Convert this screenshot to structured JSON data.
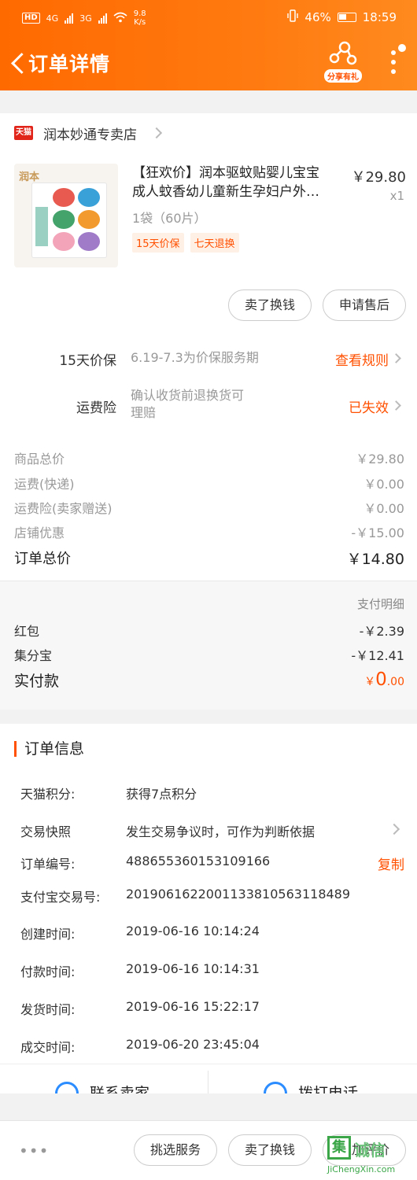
{
  "status_bar": {
    "hd": "HD",
    "net1": "4G",
    "net2": "3G",
    "speed_value": "9.8",
    "speed_unit": "K/s",
    "battery": "46%",
    "time": "18:59"
  },
  "header": {
    "title": "订单详情",
    "share_label": "分享有礼"
  },
  "store": {
    "badge": "天猫",
    "name": "润本妙通专卖店"
  },
  "product": {
    "brand_text": "润本",
    "title_line1": "【狂欢价】润本驱蚊贴婴儿宝宝",
    "title_line2": "成人蚊香幼儿童新生孕妇户外…",
    "price": "￥29.80",
    "qty": "x1",
    "spec": "1袋（60片）",
    "tags": [
      "15天价保",
      "七天退换"
    ]
  },
  "item_actions": {
    "sell_label": "卖了换钱",
    "aftersale_label": "申请售后"
  },
  "services": [
    {
      "label": "15天价保",
      "desc": "6.19-7.3为价保服务期",
      "action": "查看规则"
    },
    {
      "label": "运费险",
      "desc_line1": "确认收货前退换货可",
      "desc_line2": "理赔",
      "action": "已失效"
    }
  ],
  "price_rows": [
    {
      "label": "商品总价",
      "value": "￥29.80"
    },
    {
      "label": "运费(快递)",
      "value": "￥0.00"
    },
    {
      "label": "运费险(卖家赠送)",
      "value": "￥0.00"
    },
    {
      "label": "店铺优惠",
      "value": "-￥15.00"
    }
  ],
  "order_total": {
    "label": "订单总价",
    "value": "￥14.80"
  },
  "payment": {
    "header": "支付明细",
    "rows": [
      {
        "label": "红包",
        "value": "-￥2.39"
      },
      {
        "label": "集分宝",
        "value": "-￥12.41"
      }
    ],
    "real_label": "实付款",
    "real_currency": "￥",
    "real_int": "0",
    "real_dec": ".00"
  },
  "order_info": {
    "title": "订单信息",
    "rows": [
      {
        "key": "天猫积分:",
        "value": "获得7点积分"
      },
      {
        "key": "交易快照",
        "value": "发生交易争议时，可作为判断依据"
      },
      {
        "key": "订单编号:",
        "value": "488655360153109166",
        "action": "复制"
      },
      {
        "key": "支付宝交易号:",
        "value": "2019061622001133810563118489"
      },
      {
        "key": "创建时间:",
        "value": "2019-06-16 10:14:24"
      },
      {
        "key": "付款时间:",
        "value": "2019-06-16 10:14:31"
      },
      {
        "key": "发货时间:",
        "value": "2019-06-16 15:22:17"
      },
      {
        "key": "成交时间:",
        "value": "2019-06-20 23:45:04"
      }
    ]
  },
  "contact": {
    "seller_label": "联系卖家",
    "phone_label": "拨打电话"
  },
  "bottom_bar": {
    "more": "•••",
    "buttons": [
      "挑选服务",
      "卖了换钱",
      "追加评价"
    ]
  },
  "watermark": {
    "box": "集",
    "text": "诚信",
    "url": "JiChengXin.com"
  },
  "colors": {
    "brand_orange": "#ff5000",
    "header_bg": "#ff6a00",
    "tmall_red": "#e1251b"
  }
}
